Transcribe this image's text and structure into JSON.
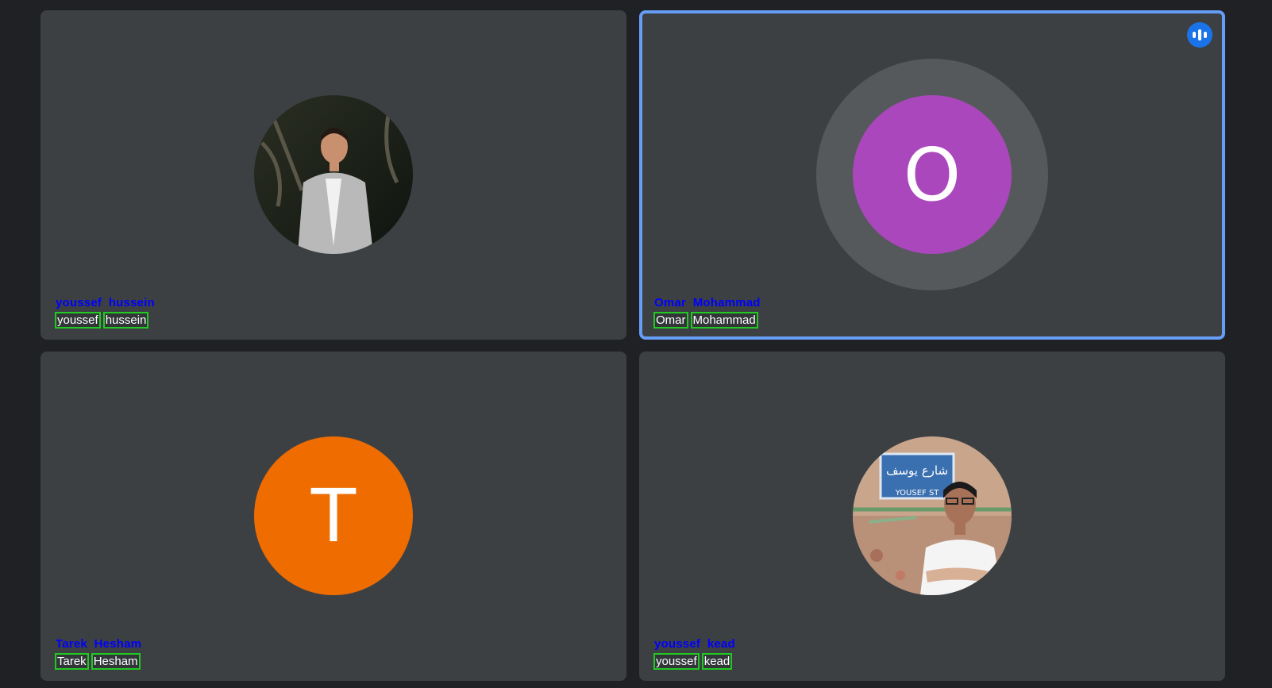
{
  "participants": [
    {
      "display_name": "youssef  hussein",
      "name_words": [
        "youssef",
        "hussein"
      ],
      "avatar": "photo-man-in-grey-suit",
      "speaking": false
    },
    {
      "display_name": "Omar  Mohammad",
      "name_words": [
        "Omar",
        "Mohammad"
      ],
      "avatar_letter": "O",
      "avatar_color": "#ab47bc",
      "speaking": true
    },
    {
      "display_name": "Tarek  Hesham",
      "name_words": [
        "Tarek",
        "Hesham"
      ],
      "avatar_letter": "T",
      "avatar_color": "#ef6c00",
      "speaking": false
    },
    {
      "display_name": "youssef  kead",
      "name_words": [
        "youssef",
        "kead"
      ],
      "avatar": "photo-man-by-yousef-st-sign",
      "speaking": false
    }
  ],
  "sign_text": {
    "arabic": "شارع يوسف",
    "latin": "YOUSEF ST"
  },
  "colors": {
    "background": "#202124",
    "tile": "#3c4043",
    "active_border": "#669df6",
    "speaking_indicator": "#1a73e8"
  },
  "icons": {
    "speaking": "audio-level-icon"
  }
}
